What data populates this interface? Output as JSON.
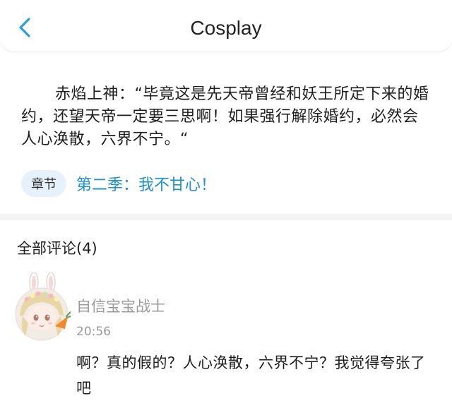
{
  "header": {
    "title": "Cosplay",
    "back_icon": "chevron-left-icon",
    "accent_color": "#2a9fe0"
  },
  "excerpt": {
    "text": "赤焰上神：“毕竟这是先天帝曾经和妖王所定下来的婚约，还望天帝一定要三思啊！如果强行解除婚约，必然会人心涣散，六界不宁。“"
  },
  "chapter": {
    "tag_label": "章节",
    "title": "第二季：我不甘心！",
    "link_color": "#1a8fd6"
  },
  "comments": {
    "heading": "全部评论(4)",
    "items": [
      {
        "username": "自信宝宝战士",
        "time": "20:56",
        "text": "啊？真的假的？人心涣散，六界不宁？我觉得夸张了吧",
        "avatar_icon": "bunny-girl-avatar"
      }
    ]
  }
}
